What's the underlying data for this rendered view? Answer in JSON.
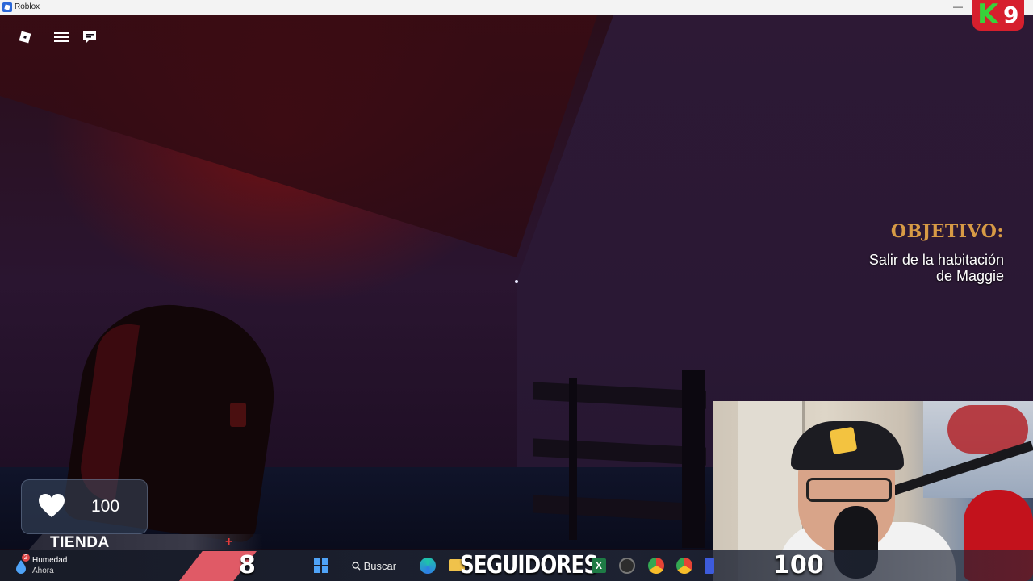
{
  "window": {
    "title": "Roblox",
    "minimize_glyph": "—"
  },
  "hud": {
    "icons": [
      "roblox-logo-icon",
      "menu-icon",
      "chat-icon"
    ],
    "objective": {
      "label": "OBJETIVO:",
      "line1": "Salir de la habitación",
      "line2": "de Maggie"
    },
    "health": {
      "value": "100"
    },
    "shop": {
      "label": "TIENDA",
      "plus": "+"
    }
  },
  "overlay": {
    "brand": {
      "letter": "K",
      "number": "9",
      "colors": {
        "bg": "#d61f2d",
        "k": "#38d23a"
      }
    },
    "followers_count": "8",
    "followers_label": "SEGUIDORES",
    "followers_goal": "100"
  },
  "taskbar": {
    "weather": {
      "title": "Humedad",
      "subtitle": "Ahora",
      "badge": "2"
    },
    "search_label": "Buscar",
    "excel_glyph": "X"
  }
}
